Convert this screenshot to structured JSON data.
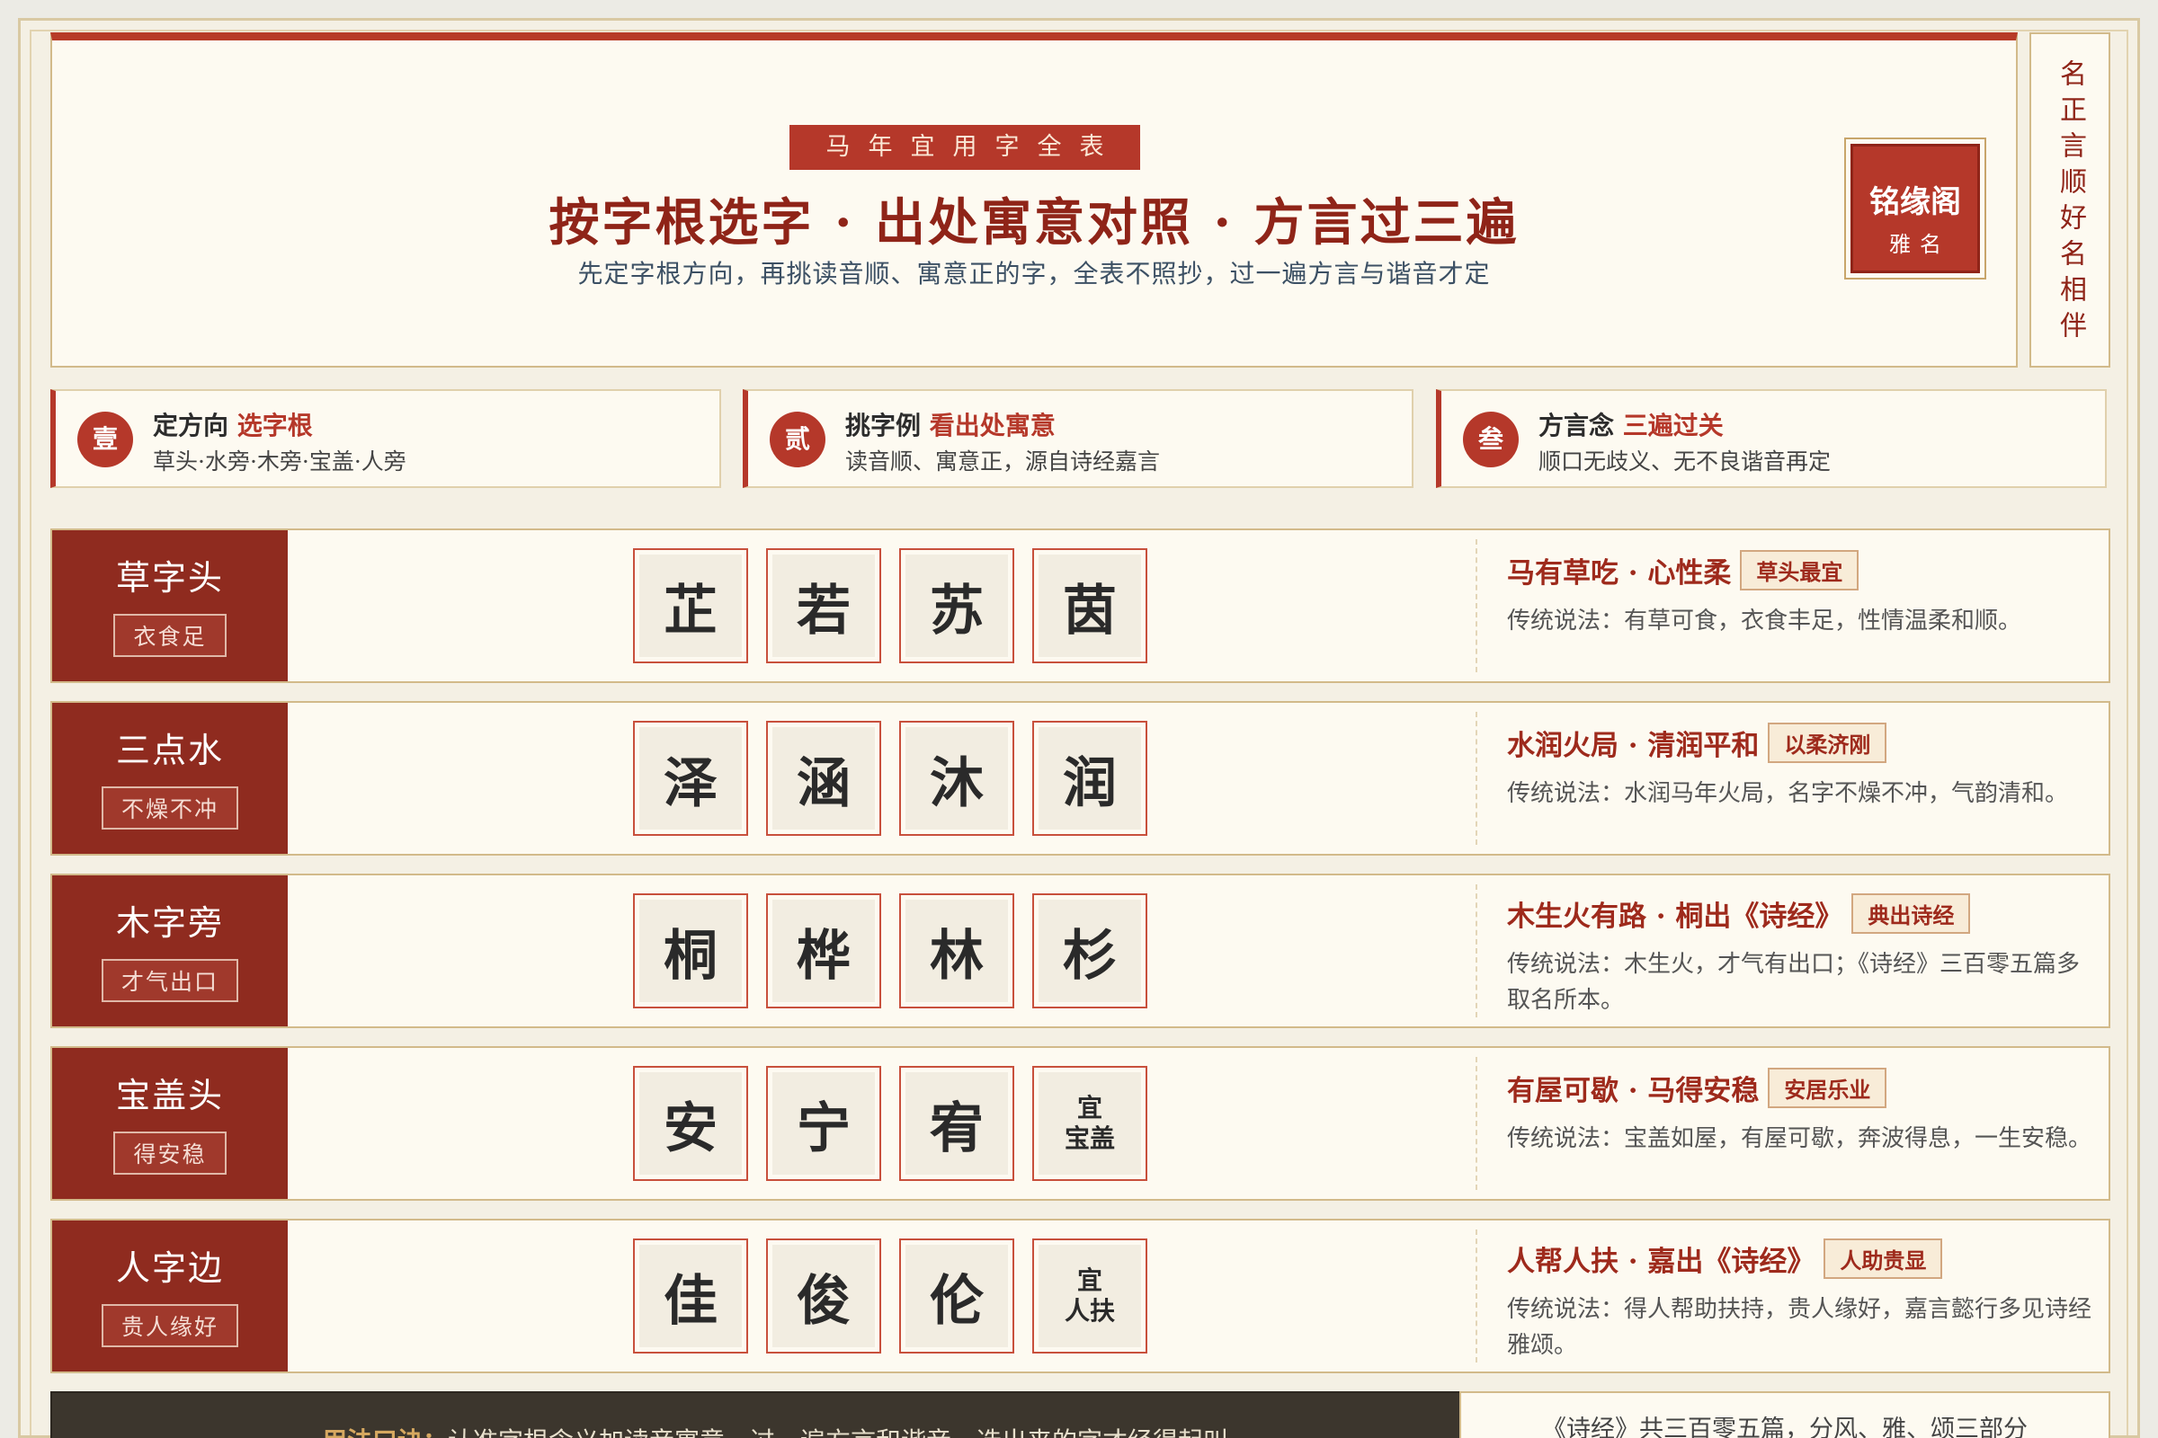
{
  "header": {
    "tag": "马年宜用字全表",
    "title": "按字根选字 · 出处寓意对照 · 方言过三遍",
    "subtitle": "先定字根方向，再挑读音顺、寓意正的字，全表不照抄，过一遍方言与谐音才定",
    "seal_main": "铭缘阁",
    "seal_sub": "雅名",
    "motto": "名正言顺好名相伴"
  },
  "steps": [
    {
      "num": "壹",
      "title": "定方向",
      "highlight": "选字根",
      "desc": "草头·水旁·木旁·宝盖·人旁"
    },
    {
      "num": "贰",
      "title": "挑字例",
      "highlight": "看出处寓意",
      "desc": "读音顺、寓意正，源自诗经嘉言"
    },
    {
      "num": "叁",
      "title": "方言念",
      "highlight": "三遍过关",
      "desc": "顺口无歧义、无不良谐音再定"
    }
  ],
  "rows": [
    {
      "name": "草字头",
      "tag": "衣食足",
      "chars": [
        "芷",
        "若",
        "苏",
        "茵"
      ],
      "info_title": "马有草吃 · 心性柔",
      "badge": "草头最宜",
      "desc": "传统说法：有草可食，衣食丰足，性情温柔和顺。"
    },
    {
      "name": "三点水",
      "tag": "不燥不冲",
      "chars": [
        "泽",
        "涵",
        "沐",
        "润"
      ],
      "info_title": "水润火局 · 清润平和",
      "badge": "以柔济刚",
      "desc": "传统说法：水润马年火局，名字不燥不冲，气韵清和。"
    },
    {
      "name": "木字旁",
      "tag": "才气出口",
      "chars": [
        "桐",
        "桦",
        "林",
        "杉"
      ],
      "info_title": "木生火有路 · 桐出《诗经》",
      "badge": "典出诗经",
      "desc": "传统说法：木生火，才气有出口；《诗经》三百零五篇多取名所本。"
    },
    {
      "name": "宝盖头",
      "tag": "得安稳",
      "chars": [
        "安",
        "宁",
        "宥"
      ],
      "note": [
        "宜",
        "宝盖"
      ],
      "info_title": "有屋可歇 · 马得安稳",
      "badge": "安居乐业",
      "desc": "传统说法：宝盖如屋，有屋可歇，奔波得息，一生安稳。"
    },
    {
      "name": "人字边",
      "tag": "贵人缘好",
      "chars": [
        "佳",
        "俊",
        "伦"
      ],
      "note": [
        "宜",
        "人扶"
      ],
      "info_title": "人帮人扶 · 嘉出《诗经》",
      "badge": "人助贵显",
      "desc": "传统说法：得人帮助扶持，贵人缘好，嘉言懿行多见诗经雅颂。"
    }
  ],
  "bottom": {
    "lead": "用法口诀：",
    "text": "认准字根含义加读音寓意，过一遍方言和谐音，选出来的字才经得起叫",
    "note": "《诗经》共三百零五篇，分风、雅、颂三部分"
  }
}
